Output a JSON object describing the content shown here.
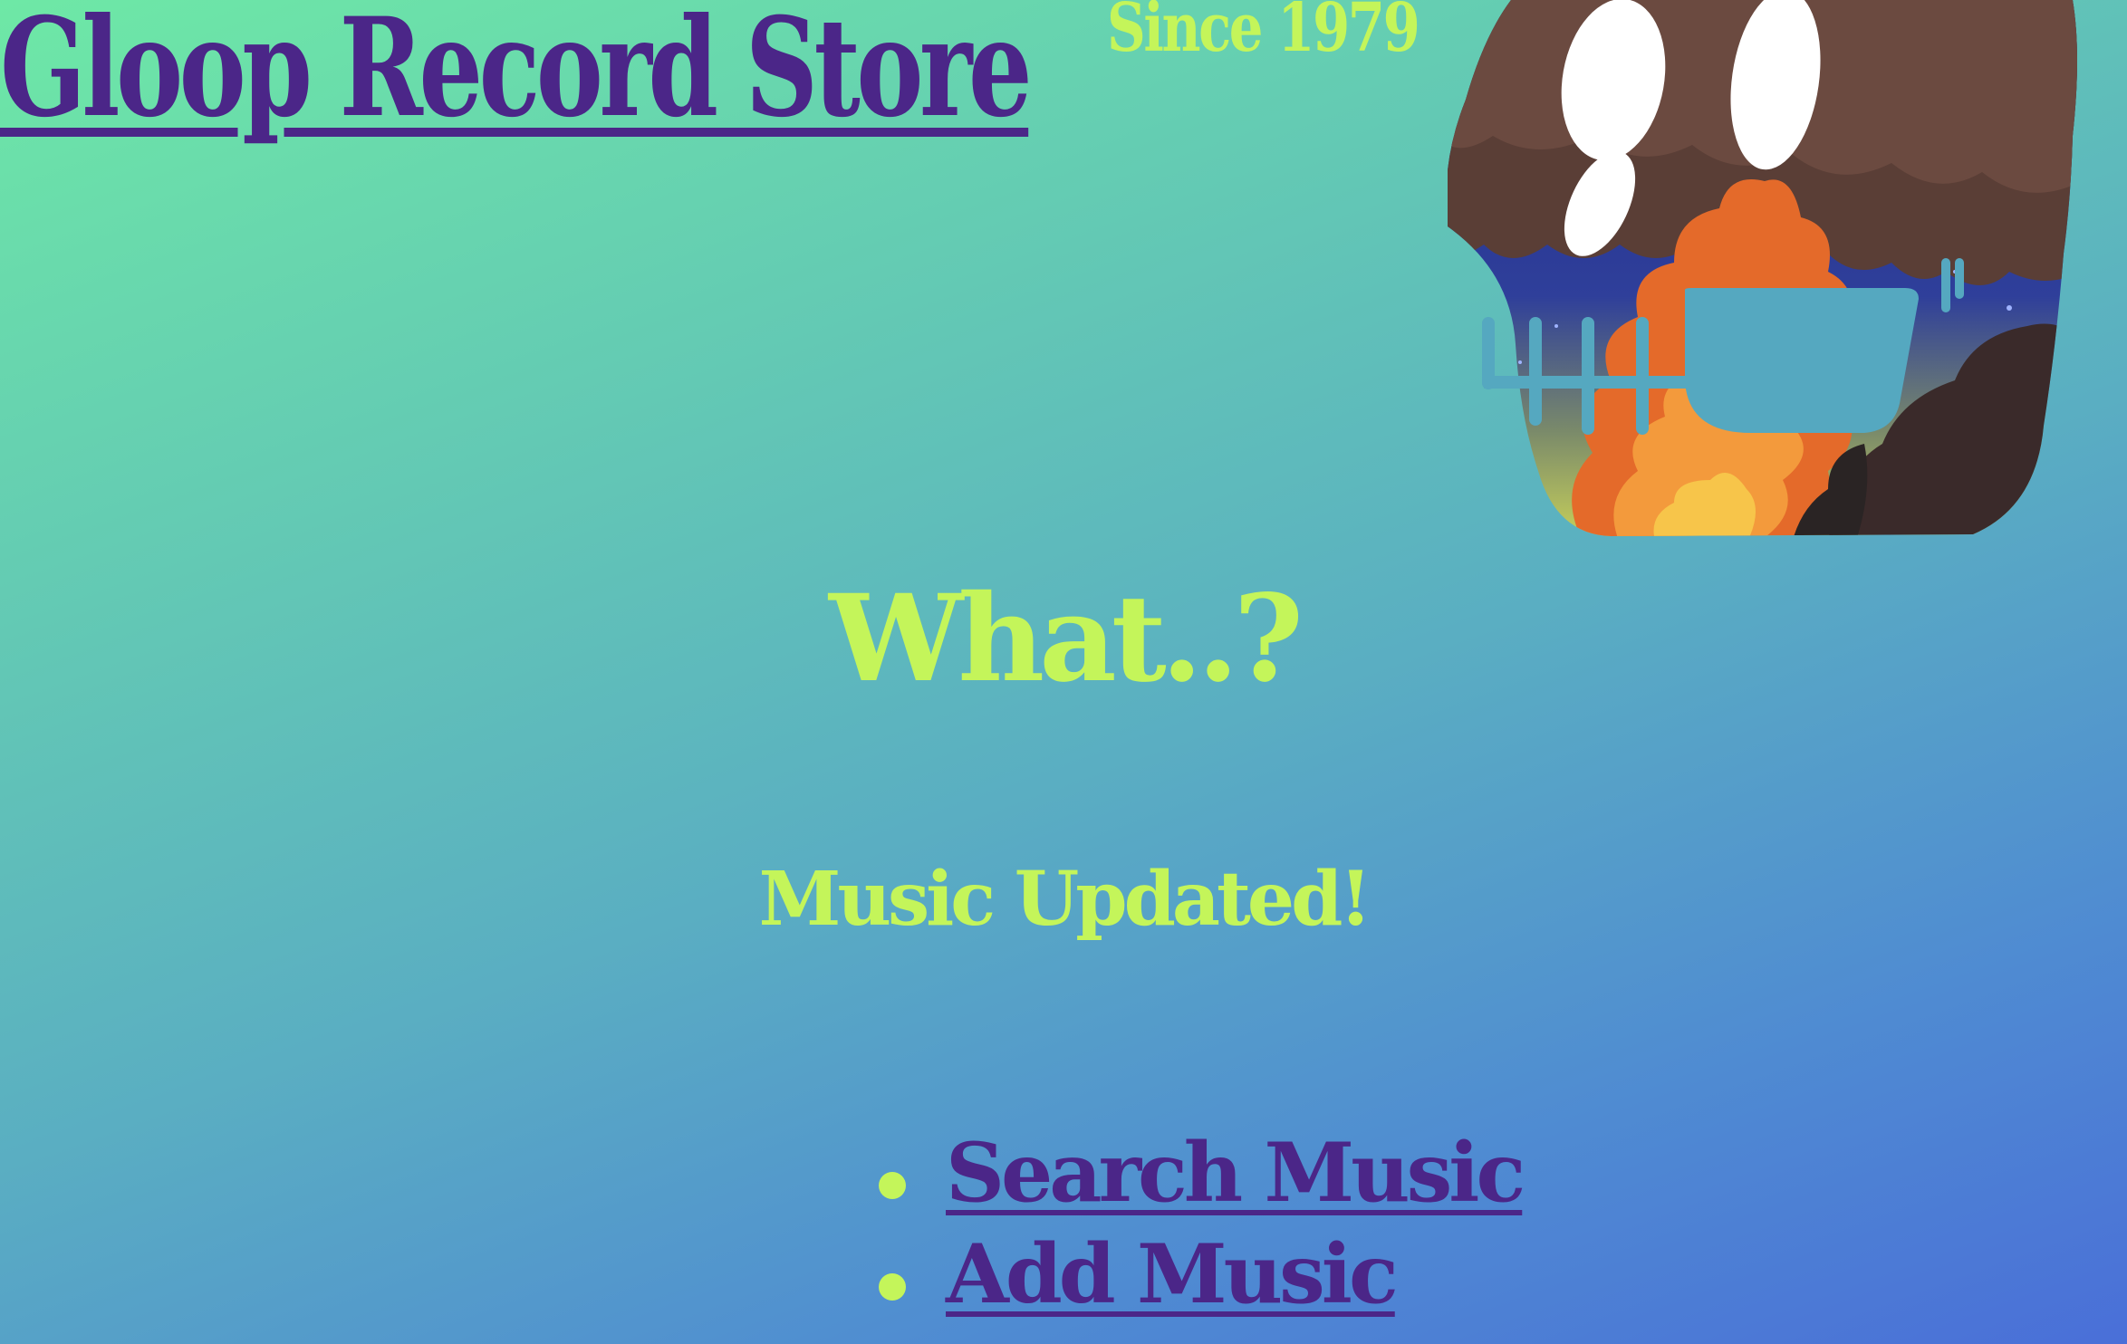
{
  "brand": {
    "title": "Gloop Record Store",
    "since": "Since 1979",
    "logo_icon": "skull-mushroom-logo-icon"
  },
  "main": {
    "heading": "What..?",
    "status": "Music Updated!"
  },
  "nav": {
    "items": [
      {
        "label": "Search Music"
      },
      {
        "label": "Add Music"
      }
    ]
  },
  "colors": {
    "title_purple": "#4b2688",
    "accent_lime": "#c4f55a",
    "gradient_start": "#6ee8a6",
    "gradient_end": "#4a6fd8"
  }
}
